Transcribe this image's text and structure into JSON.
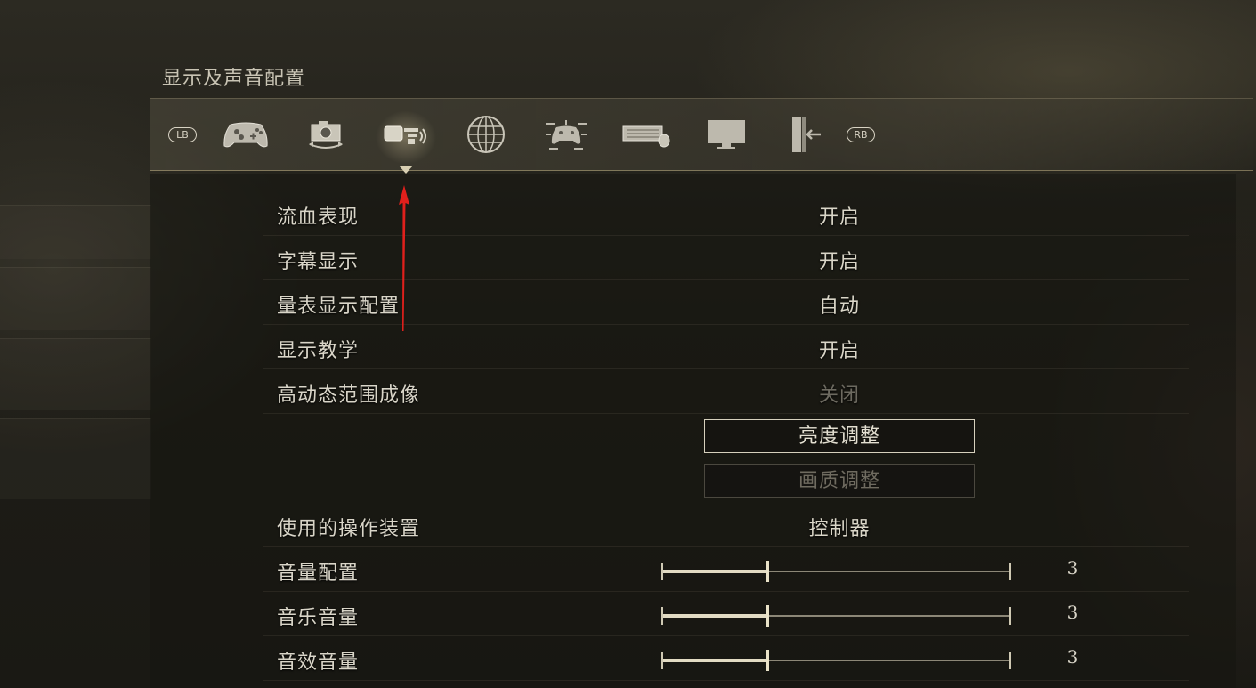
{
  "page": {
    "title": "显示及声音配置"
  },
  "tabs": {
    "left_bumper": "LB",
    "right_bumper": "RB",
    "items": [
      {
        "icon": "gamepad-icon"
      },
      {
        "icon": "camera-icon"
      },
      {
        "icon": "display-sound-icon",
        "active": true
      },
      {
        "icon": "globe-icon"
      },
      {
        "icon": "controller-mapping-icon"
      },
      {
        "icon": "keyboard-mouse-icon"
      },
      {
        "icon": "monitor-icon"
      },
      {
        "icon": "exit-door-icon"
      }
    ]
  },
  "settings": {
    "blood": {
      "label": "流血表现",
      "value": "开启"
    },
    "subtitles": {
      "label": "字幕显示",
      "value": "开启"
    },
    "hud": {
      "label": "量表显示配置",
      "value": "自动"
    },
    "tutorials": {
      "label": "显示教学",
      "value": "开启"
    },
    "hdr": {
      "label": "高动态范围成像",
      "value": "关闭",
      "disabled": true
    },
    "brightness_button": "亮度调整",
    "quality_button": "画质调整",
    "input_device": {
      "label": "使用的操作装置",
      "value": "控制器"
    },
    "master_volume": {
      "label": "音量配置",
      "value": "3",
      "level": 0.3
    },
    "music_volume": {
      "label": "音乐音量",
      "value": "3",
      "level": 0.3
    },
    "sfx_volume": {
      "label": "音效音量",
      "value": "3",
      "level": 0.3
    }
  },
  "colors": {
    "accent": "#d8cfb2",
    "text": "#d9d5c8",
    "disabled": "#6d6a60",
    "annotation_arrow": "#e0201c"
  }
}
